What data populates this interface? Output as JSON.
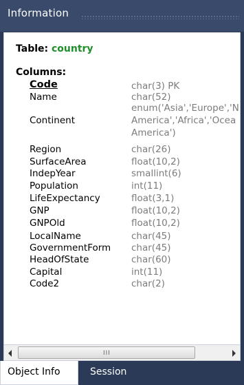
{
  "panel": {
    "title": "Information"
  },
  "table": {
    "prefix": "Table:",
    "name": "country"
  },
  "columns_label": "Columns:",
  "columns": [
    {
      "name": "Code",
      "type": "char(3) PK",
      "pk": true
    },
    {
      "name": "Name",
      "type": "char(52)"
    },
    {
      "name": "Continent",
      "type_lines": [
        "enum('Asia','Europe','N",
        "America','Africa','Ocea",
        "America')"
      ]
    },
    {
      "name": "Region",
      "type": "char(26)"
    },
    {
      "name": "SurfaceArea",
      "type": "float(10,2)"
    },
    {
      "name": "IndepYear",
      "type": "smallint(6)"
    },
    {
      "name": "Population",
      "type": "int(11)"
    },
    {
      "name": "LifeExpectancy",
      "type": "float(3,1)"
    },
    {
      "name": "GNP",
      "type": "float(10,2)"
    },
    {
      "name": "GNPOld",
      "type": "float(10,2)"
    },
    {
      "name": "LocalName",
      "type": "char(45)"
    },
    {
      "name": "GovernmentForm",
      "type": "char(45)"
    },
    {
      "name": "HeadOfState",
      "type": "char(60)"
    },
    {
      "name": "Capital",
      "type": "int(11)"
    },
    {
      "name": "Code2",
      "type": "char(2)"
    }
  ],
  "scrollbar": {
    "grip": "III"
  },
  "tabs": [
    {
      "label": "Object Info",
      "active": true
    },
    {
      "label": "Session",
      "active": false
    }
  ]
}
